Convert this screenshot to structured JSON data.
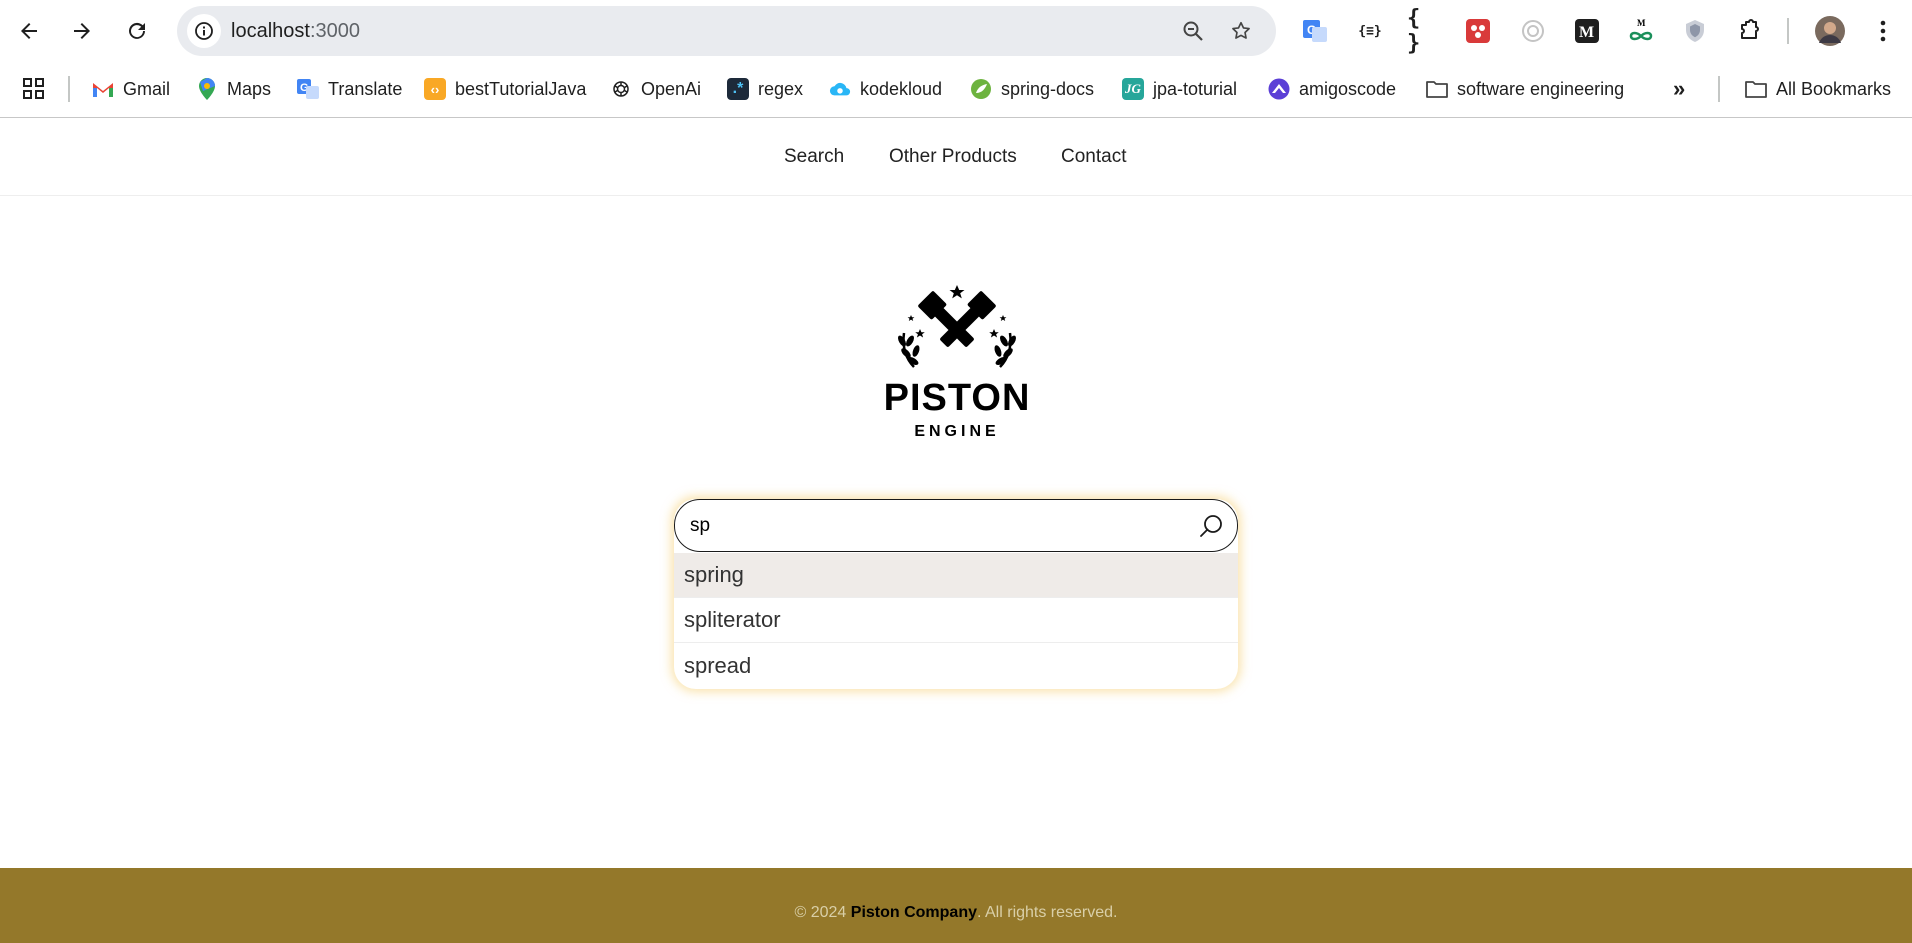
{
  "browser": {
    "url_host": "localhost",
    "url_port": ":3000",
    "bookmarks": [
      {
        "label": "Gmail",
        "icon": "gmail-icon"
      },
      {
        "label": "Maps",
        "icon": "maps-icon"
      },
      {
        "label": "Translate",
        "icon": "translate-icon"
      },
      {
        "label": "bestTutorialJava",
        "icon": "code-icon"
      },
      {
        "label": "OpenAi",
        "icon": "openai-icon"
      },
      {
        "label": "regex",
        "icon": "regex-icon"
      },
      {
        "label": "kodekloud",
        "icon": "kodekloud-icon"
      },
      {
        "label": "spring-docs",
        "icon": "spring-icon"
      },
      {
        "label": "jpa-toturial",
        "icon": "jpa-icon"
      },
      {
        "label": "amigoscode",
        "icon": "amigoscode-icon"
      },
      {
        "label": "software engineering",
        "icon": "folder-icon"
      }
    ],
    "all_bookmarks_label": "All Bookmarks"
  },
  "site": {
    "nav": [
      "Search",
      "Other Products",
      "Contact"
    ],
    "logo_title": "PISTON",
    "logo_subtitle": "ENGINE",
    "search": {
      "value": "sp",
      "suggestions": [
        "spring",
        "spliterator",
        "spread"
      ]
    },
    "footer": {
      "prefix": "© 2024 ",
      "company": "Piston Company",
      "suffix": ". All rights reserved."
    }
  },
  "colors": {
    "footer_bg": "#94782a",
    "search_glow": "#f5cd6e",
    "active_suggestion_bg": "#efebe8"
  }
}
